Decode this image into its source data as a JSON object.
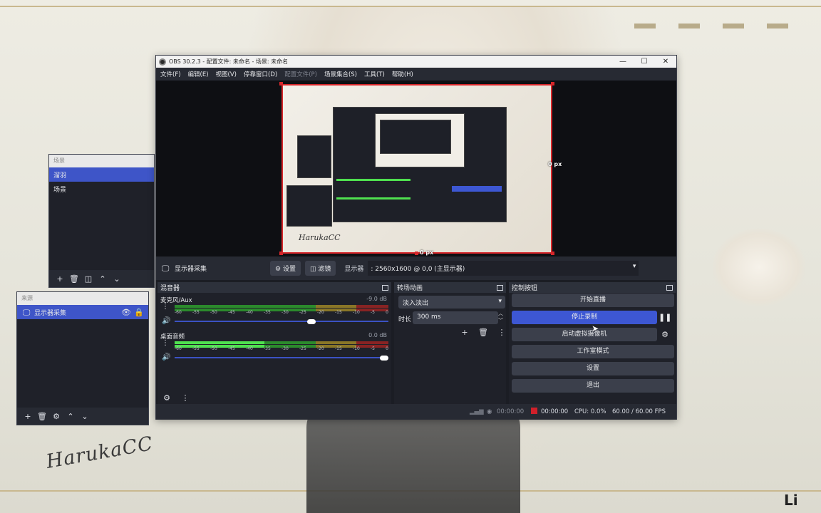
{
  "desktop": {
    "signature": "HarukaCC",
    "corner_logo": "Li"
  },
  "scenes_dock": {
    "title": "场景",
    "items": [
      {
        "label": "溜羽",
        "selected": true
      },
      {
        "label": "场景",
        "selected": false
      }
    ]
  },
  "sources_dock": {
    "title": "来源",
    "items": [
      {
        "label": "显示器采集",
        "icon": "monitor-icon",
        "selected": true
      }
    ]
  },
  "window": {
    "title": "OBS 30.2.3 - 配置文件: 未命名 - 场景: 未命名",
    "menu": [
      "文件(F)",
      "编辑(E)",
      "视图(V)",
      "停靠窗口(D)",
      "配置文件(P)",
      "场景集合(S)",
      "工具(T)",
      "帮助(H)"
    ],
    "menu_disabled": [
      "配置文件(P)"
    ]
  },
  "preview": {
    "px_right": "0 px",
    "px_bottom": "0 px",
    "nested_signature": "HarukaCC"
  },
  "source_toolbar": {
    "source_name": "显示器采集",
    "settings_label": "设置",
    "filters_label": "滤镜",
    "display_label": "显示器",
    "display_value": ": 2560x1600 @ 0,0 (主显示器)"
  },
  "mixer": {
    "title": "混音器",
    "ticks": [
      "-60",
      "-55",
      "-50",
      "-45",
      "-40",
      "-35",
      "-30",
      "-25",
      "-20",
      "-15",
      "-10",
      "-5",
      "0"
    ],
    "channels": [
      {
        "name": "麦克风/Aux",
        "db": "-9.0 dB",
        "level": 0.0,
        "volume": 0.66
      },
      {
        "name": "桌面音频",
        "db": "0.0 dB",
        "level": 0.42,
        "volume": 1.0
      }
    ]
  },
  "transitions": {
    "title": "转场动画",
    "selected": "淡入淡出",
    "duration_label": "时长",
    "duration_value": "300 ms"
  },
  "controls": {
    "title": "控制按钮",
    "start_stream": "开始直播",
    "stop_recording": "停止录制",
    "virtual_camera": "启动虚拟摄像机",
    "studio_mode": "工作室模式",
    "settings": "设置",
    "exit": "退出"
  },
  "status": {
    "stream_time": "00:00:00",
    "rec_time": "00:00:00",
    "cpu": "CPU: 0.0%",
    "fps": "60.00 / 60.00 FPS"
  },
  "colors": {
    "accent": "#3d57d3",
    "recording": "#d0202a",
    "bg": "#1f2129"
  }
}
